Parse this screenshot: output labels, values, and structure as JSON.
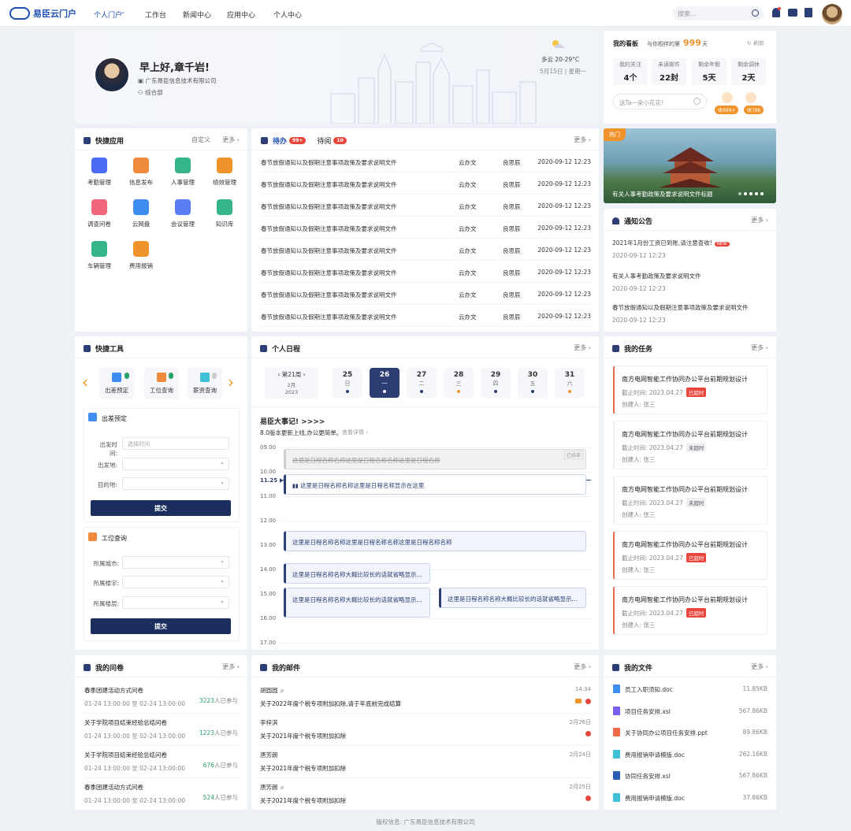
{
  "nav": {
    "brand": "易臣云门户",
    "items": [
      "个人门户",
      "工作台",
      "新闻中心",
      "应用中心",
      "个人中心"
    ],
    "search_placeholder": "搜索..."
  },
  "greeting": {
    "title": "早上好,章千岩!",
    "company": "广东易臣信息技术有限公司",
    "dept": "综合部",
    "weather": "多云  20-29°C",
    "date": "5月15日 | 星期一"
  },
  "board": {
    "title": "我的看板",
    "companion_prefix": "与你相伴的第",
    "companion_days": "999",
    "companion_suffix": "天",
    "refresh": "刷新",
    "stats": [
      {
        "label": "我的关注",
        "value": "4个"
      },
      {
        "label": "未读邮件",
        "value": "22封"
      },
      {
        "label": "剩余年假",
        "value": "5天"
      },
      {
        "label": "剩余调休",
        "value": "2天"
      }
    ],
    "flower_placeholder": "送Ta一朵小花花!",
    "received_1": "收999+",
    "received_2": "收786"
  },
  "quick_apps": {
    "title": "快捷应用",
    "customize": "自定义",
    "more": "更多",
    "items": [
      {
        "label": "考勤管理",
        "color": "#4a6cf7"
      },
      {
        "label": "信息发布",
        "color": "#f08a3c"
      },
      {
        "label": "人事管理",
        "color": "#37b58a"
      },
      {
        "label": "绩效管理",
        "color": "#f0932b"
      },
      {
        "label": "调查问卷",
        "color": "#f0667a"
      },
      {
        "label": "云网盘",
        "color": "#3d8ef0"
      },
      {
        "label": "会议管理",
        "color": "#5b7ef5"
      },
      {
        "label": "知识库",
        "color": "#37b58a"
      },
      {
        "label": "车辆管理",
        "color": "#37b58a"
      },
      {
        "label": "费用报销",
        "color": "#f0932b"
      }
    ]
  },
  "todo": {
    "tab1": "待办",
    "tab1_count": "99+",
    "tab2": "待阅",
    "tab2_count": "10",
    "more": "更多",
    "rows": [
      {
        "title": "春节放假通知以及假期注意事项政策及要求说明文件",
        "source": "云办文",
        "person": "良思辰",
        "time": "2020-09-12 12:23"
      },
      {
        "title": "春节放假通知以及假期注意事项政策及要求说明文件",
        "source": "云办文",
        "person": "良思辰",
        "time": "2020-09-12 12:23"
      },
      {
        "title": "春节放假通知以及假期注意事项政策及要求说明文件",
        "source": "云办文",
        "person": "良思辰",
        "time": "2020-09-12 12:23"
      },
      {
        "title": "春节放假通知以及假期注意事项政策及要求说明文件",
        "source": "云办文",
        "person": "良思辰",
        "time": "2020-09-12 12:23"
      },
      {
        "title": "春节放假通知以及假期注意事项政策及要求说明文件",
        "source": "云办文",
        "person": "良思辰",
        "time": "2020-09-12 12:23"
      },
      {
        "title": "春节放假通知以及假期注意事项政策及要求说明文件",
        "source": "云办文",
        "person": "良思辰",
        "time": "2020-09-12 12:23"
      },
      {
        "title": "春节放假通知以及假期注意事项政策及要求说明文件",
        "source": "云办文",
        "person": "良思辰",
        "time": "2020-09-12 12:23"
      },
      {
        "title": "春节放假通知以及假期注意事项政策及要求说明文件",
        "source": "云办文",
        "person": "良思辰",
        "time": "2020-09-12 12:23"
      }
    ]
  },
  "banner": {
    "tag": "热门",
    "caption": "有关人事考勤政策及要求说明文件标题"
  },
  "notices": {
    "title": "通知公告",
    "more": "更多",
    "new_badge": "NEW",
    "items": [
      {
        "title": "2021年1月份工资已到账,请注意查收!",
        "date": "2020-09-12 12:23"
      },
      {
        "title": "有关人事考勤政策及要求说明文件",
        "date": "2020-09-12 12:23"
      },
      {
        "title": "春节放假通知以及假期注意事项政策及要求说明文件",
        "date": "2020-09-12 12:23"
      }
    ]
  },
  "quick_tools": {
    "title": "快捷工具",
    "tools": [
      "出差预定",
      "工位查询",
      "薪资查询"
    ],
    "trip": {
      "title": "出差预定",
      "time_label": "出发时间:",
      "time_placeholder": "选择时间",
      "from_label": "出发地:",
      "to_label": "目的地:",
      "submit": "提交"
    },
    "seat": {
      "title": "工位查询",
      "city_label": "所属城市:",
      "building_label": "所属楼宇:",
      "floor_label": "所属楼层:",
      "submit": "提交"
    }
  },
  "schedule": {
    "title": "个人日程",
    "more": "更多",
    "week": "第21周",
    "month": "2月",
    "year": "2023",
    "days": [
      {
        "n": "25",
        "w": "日"
      },
      {
        "n": "26",
        "w": "一"
      },
      {
        "n": "27",
        "w": "二"
      },
      {
        "n": "28",
        "w": "三"
      },
      {
        "n": "29",
        "w": "四"
      },
      {
        "n": "30",
        "w": "五"
      },
      {
        "n": "31",
        "w": "六"
      }
    ],
    "headline": "易臣大事记!",
    "headline_arrows": ">>>>",
    "sub": "8.0版本更新上线,办公更简单。",
    "sub_link": "查看详情",
    "hours": [
      "09.00",
      "10.00",
      "11.25",
      "11.00",
      "12.00",
      "13.00",
      "14.00",
      "15.00",
      "16.00",
      "17.00"
    ],
    "done_tag": "已结束",
    "events": [
      "这里是日程名称名称这里是日程名称名称这里是日程名称",
      "这里是日程名称名称这里是日程名称显示在这里",
      "这里是日程名称名称这里是日程名称名称这里是日程名称名称",
      "这里是日程名称名称大概比较长的话就省略显示...",
      "这里是日程名称名称大概比较长的话就省略显示...",
      "这里是日程名称名称大概比较长的话就省略显示..."
    ]
  },
  "tasks": {
    "title": "我的任务",
    "more": "更多",
    "items": [
      {
        "title": "南方电网智能工作协同办公平台前期规划设计",
        "deadline": "截止时间: 2023.04.27",
        "status": "已超时",
        "creator": "创建人: 张三"
      },
      {
        "title": "南方电网智能工作协同办公平台前期规划设计",
        "deadline": "截止时间: 2023.04.27",
        "status": "未超时",
        "creator": "创建人: 张三"
      },
      {
        "title": "南方电网智能工作协同办公平台前期规划设计",
        "deadline": "截止时间: 2023.04.27",
        "status": "未超时",
        "creator": "创建人: 张三"
      },
      {
        "title": "南方电网智能工作协同办公平台前期规划设计",
        "deadline": "截止时间: 2023.04.27",
        "status": "已超时",
        "creator": "创建人: 张三"
      },
      {
        "title": "南方电网智能工作协同办公平台前期规划设计",
        "deadline": "截止时间: 2023.04.27",
        "status": "已超时",
        "creator": "创建人: 张三"
      }
    ]
  },
  "surveys": {
    "title": "我的问卷",
    "more": "更多",
    "suffix": "人已参与",
    "items": [
      {
        "title": "春季团建活动方式问卷",
        "range": "01-24 13:00:00 至 02-24 13:00:00",
        "count": "3223"
      },
      {
        "title": "关于学院项目结束经验总结问卷",
        "range": "01-24 13:00:00 至 02-24 13:00:00",
        "count": "1223"
      },
      {
        "title": "关于学院项目结束经验总结问卷",
        "range": "01-24 13:00:00 至 02-24 13:00:00",
        "count": "676"
      },
      {
        "title": "春季团建活动方式问卷",
        "range": "01-24 13:00:00 至 02-24 13:00:00",
        "count": "524"
      }
    ]
  },
  "mails": {
    "title": "我的邮件",
    "more": "更多",
    "items": [
      {
        "from": "胡圆圆",
        "subject": "关于2022年度个税专项附加扣除,请于年底前完成结算",
        "time": "14:34"
      },
      {
        "from": "李梓淇",
        "subject": "关于2021年度个税专项附加扣除",
        "time": "2月26日"
      },
      {
        "from": "唐芳朗",
        "subject": "关于2021年度个税专项附加扣除",
        "time": "2月24日"
      },
      {
        "from": "唐芳朗",
        "subject": "关于2021年度个税专项附加扣除",
        "time": "2月25日"
      }
    ]
  },
  "files": {
    "title": "我的文件",
    "more": "更多",
    "items": [
      {
        "name": "员工入职须知.doc",
        "size": "11.85KB",
        "color": "#3d8ef0"
      },
      {
        "name": "项目任务安排.xsl",
        "size": "567.86KB",
        "color": "#7b5cf0"
      },
      {
        "name": "关于协同办公项目任务安排.ppt",
        "size": "89.86KB",
        "color": "#f06a4a"
      },
      {
        "name": "费用报销申请模版.doc",
        "size": "262.16KB",
        "color": "#3fc0d6"
      },
      {
        "name": "协同任务安排.xsl",
        "size": "567.86KB",
        "color": "#2c5fb3"
      },
      {
        "name": "费用报销申请模版.doc",
        "size": "37.86KB",
        "color": "#3fc0d6"
      }
    ]
  },
  "footer": "版权信息: 广东易臣信息技术有限公司"
}
